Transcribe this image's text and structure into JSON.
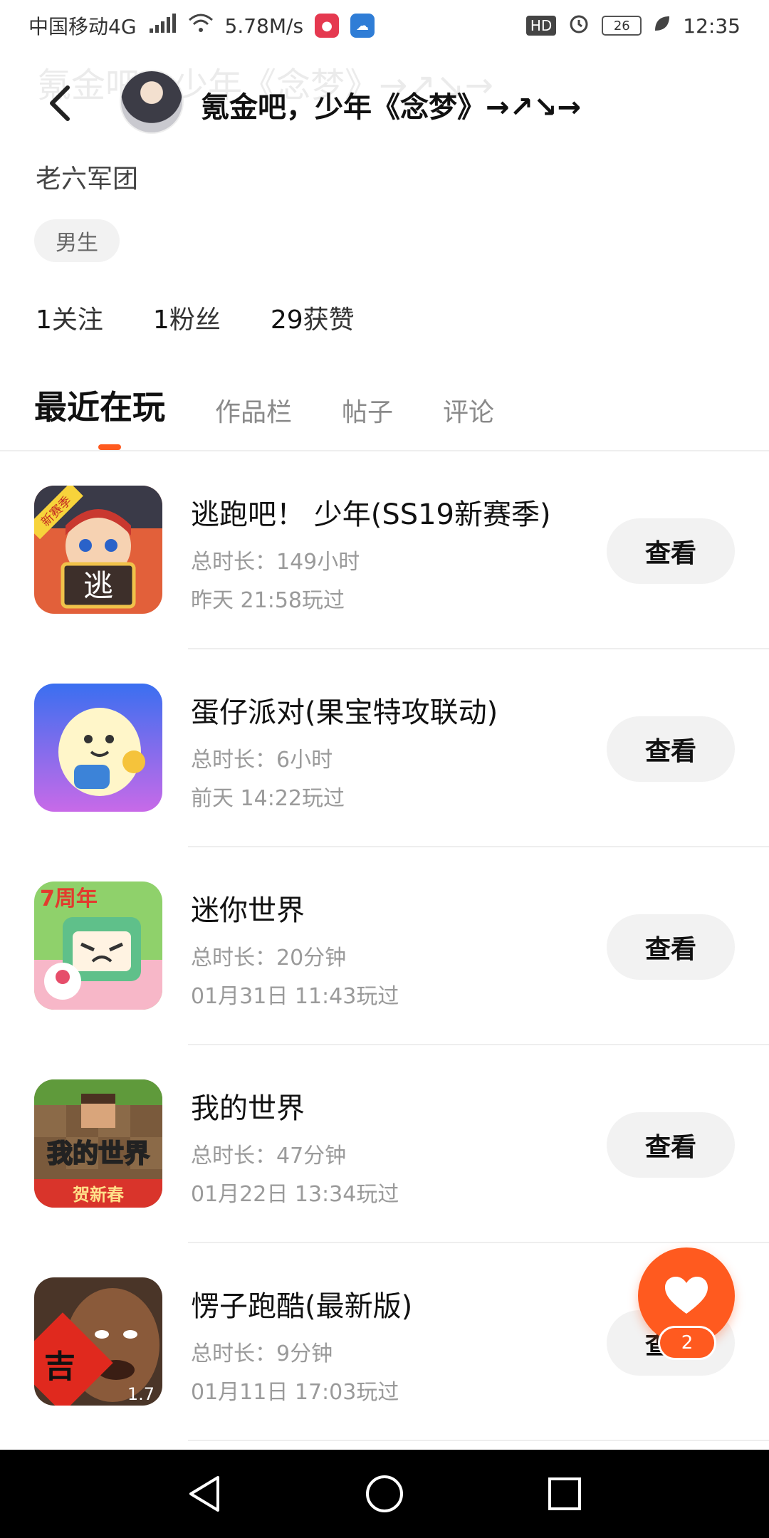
{
  "status_bar": {
    "carrier": "中国移动4G",
    "net_type": "4G",
    "speed": "5.78M/s",
    "hd": "HD",
    "battery": "26",
    "time": "12:35"
  },
  "header": {
    "title": "氪金吧，少年《念梦》→↗↘→"
  },
  "profile": {
    "signature": "老六军团",
    "gender": "男生",
    "stats": [
      {
        "num": "1",
        "label": "关注"
      },
      {
        "num": "1",
        "label": "粉丝"
      },
      {
        "num": "29",
        "label": "获赞"
      }
    ]
  },
  "tabs": [
    {
      "label": "最近在玩"
    },
    {
      "label": "作品栏"
    },
    {
      "label": "帖子"
    },
    {
      "label": "评论"
    }
  ],
  "games": [
    {
      "name": "逃跑吧！ 少年(SS19新赛季)",
      "duration": "总时长：149小时",
      "last_played": "昨天 21:58玩过",
      "button": "查看",
      "icon_text": "逃",
      "icon_badge": "新赛季",
      "icon_name": "game-icon-taopaoba"
    },
    {
      "name": "蛋仔派对(果宝特攻联动)",
      "duration": "总时长：6小时",
      "last_played": "前天 14:22玩过",
      "button": "查看",
      "icon_name": "game-icon-danzai"
    },
    {
      "name": "迷你世界",
      "duration": "总时长：20分钟",
      "last_played": "01月31日 11:43玩过",
      "button": "查看",
      "icon_text": "7周年",
      "icon_name": "game-icon-mini-world"
    },
    {
      "name": "我的世界",
      "duration": "总时长：47分钟",
      "last_played": "01月22日 13:34玩过",
      "button": "查看",
      "icon_text": "我的世界",
      "icon_badge": "贺新春",
      "icon_name": "game-icon-minecraft"
    },
    {
      "name": "愣子跑酷(最新版)",
      "duration": "总时长：9分钟",
      "last_played": "01月11日 17:03玩过",
      "button": "查看",
      "icon_text": "吉",
      "icon_badge": "1.7",
      "icon_name": "game-icon-parkour"
    }
  ],
  "fab": {
    "count": "2"
  },
  "colors": {
    "accent": "#ff5a1f",
    "button_bg": "#f2f2f2",
    "divider": "#eeeeee"
  }
}
